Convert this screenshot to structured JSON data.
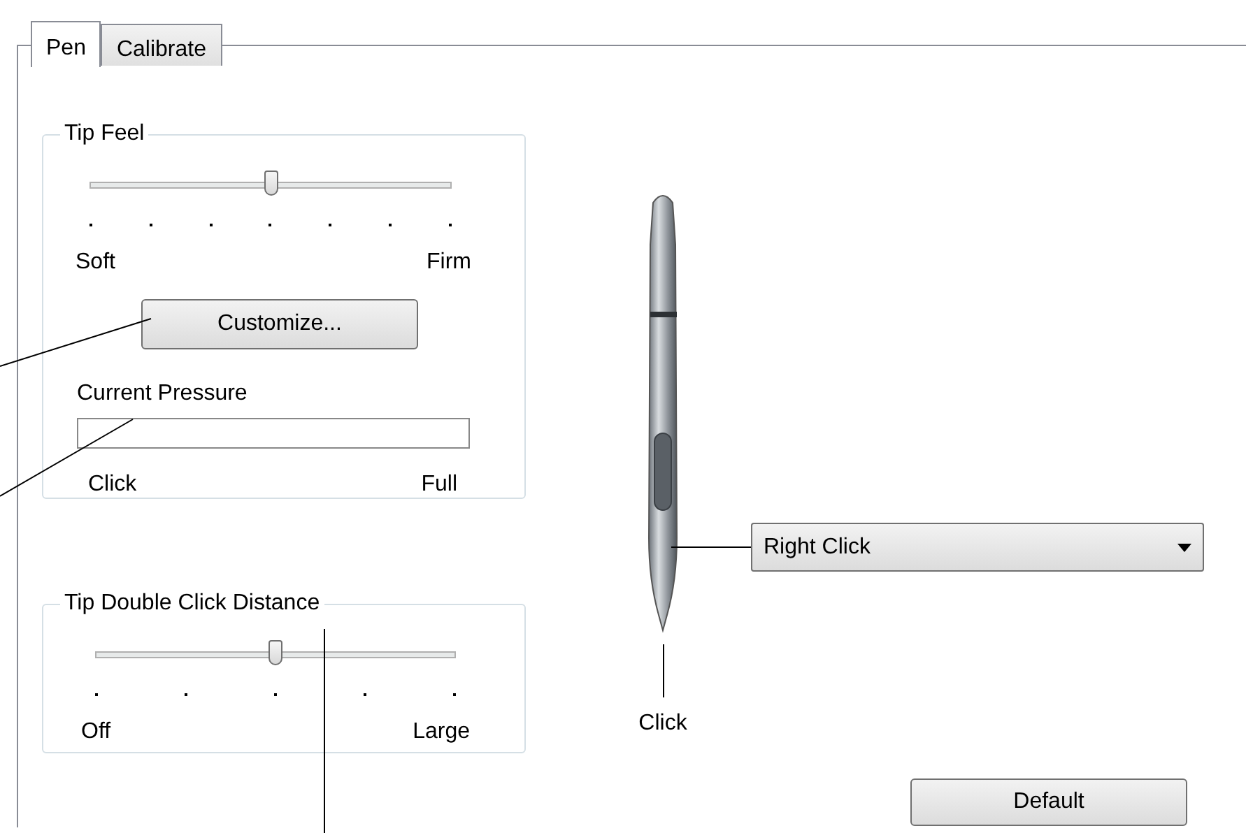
{
  "tabs": [
    {
      "label": "Pen",
      "selected": true
    },
    {
      "label": "Calibrate",
      "selected": false
    }
  ],
  "tip_feel": {
    "title": "Tip Feel",
    "slider": {
      "level": 0.5,
      "min_label": "Soft",
      "max_label": "Firm"
    },
    "customize_button": "Customize...",
    "pressure": {
      "label": "Current Pressure",
      "min_label": "Click",
      "max_label": "Full"
    }
  },
  "double_click": {
    "title": "Tip Double Click Distance",
    "slider": {
      "level": 0.5,
      "min_label": "Off",
      "max_label": "Large"
    }
  },
  "side_switch": {
    "value": "Right Click"
  },
  "tip": {
    "label": "Click"
  },
  "default_button": "Default"
}
